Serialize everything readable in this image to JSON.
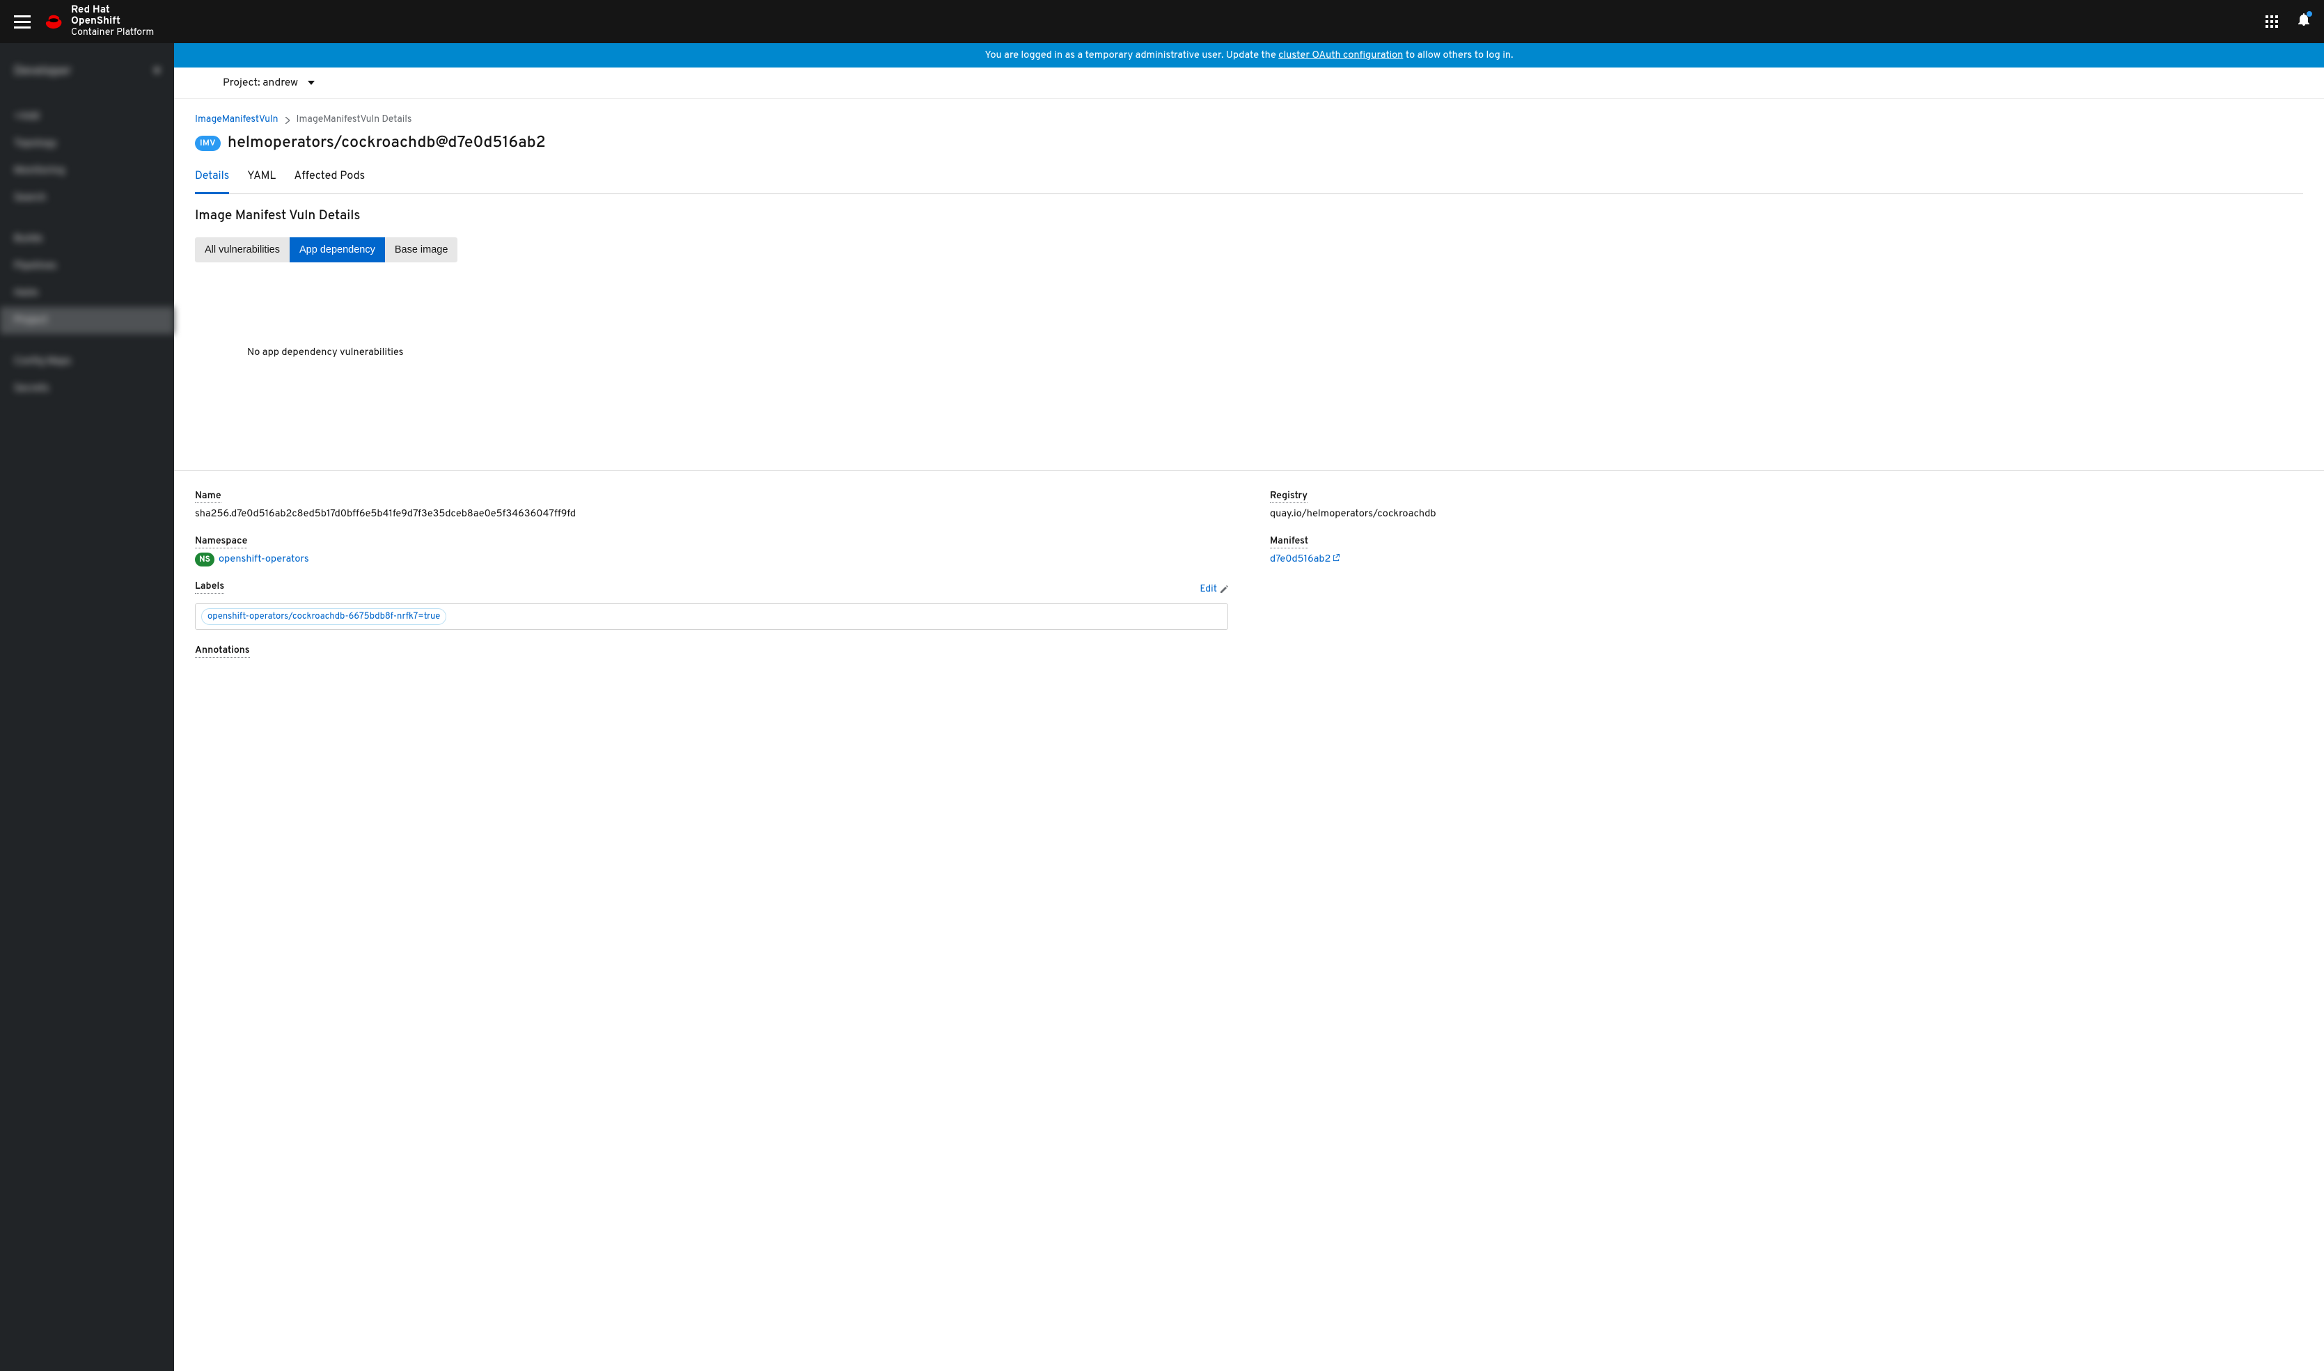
{
  "brand": {
    "line1": "Red Hat",
    "line2": "OpenShift",
    "line3": "Container Platform"
  },
  "banner": {
    "prefix": "You are logged in as a temporary administrative user. Update the ",
    "link": "cluster OAuth configuration",
    "suffix": " to allow others to log in."
  },
  "project": {
    "label": "Project: andrew"
  },
  "sidebar": {
    "perspective": "Developer",
    "items": [
      "+Add",
      "Topology",
      "Monitoring",
      "Search",
      "Builds",
      "Pipelines",
      "Helm",
      "Project",
      "Config Maps",
      "Secrets"
    ]
  },
  "breadcrumb": {
    "root": "ImageManifestVuln",
    "current": "ImageManifestVuln Details"
  },
  "badge": "IMV",
  "title": "helmoperators/cockroachdb@d7e0d516ab2",
  "tabs": {
    "details": "Details",
    "yaml": "YAML",
    "affected": "Affected Pods"
  },
  "section_title": "Image Manifest Vuln Details",
  "filters": {
    "all": "All vulnerabilities",
    "app": "App dependency",
    "base": "Base image"
  },
  "empty": "No app dependency vulnerabilities",
  "fields": {
    "name_label": "Name",
    "name_value": "sha256.d7e0d516ab2c8ed5b17d0bff6e5b41fe9d7f3e35dceb8ae0e5f34636047ff9fd",
    "namespace_label": "Namespace",
    "namespace_badge": "NS",
    "namespace_value": "openshift-operators",
    "labels_label": "Labels",
    "edit": "Edit",
    "label_chip": "openshift-operators/cockroachdb-6675bdb8f-nrfk7=true",
    "annotations_label": "Annotations",
    "registry_label": "Registry",
    "registry_value": "quay.io/helmoperators/cockroachdb",
    "manifest_label": "Manifest",
    "manifest_value": "d7e0d516ab2"
  }
}
